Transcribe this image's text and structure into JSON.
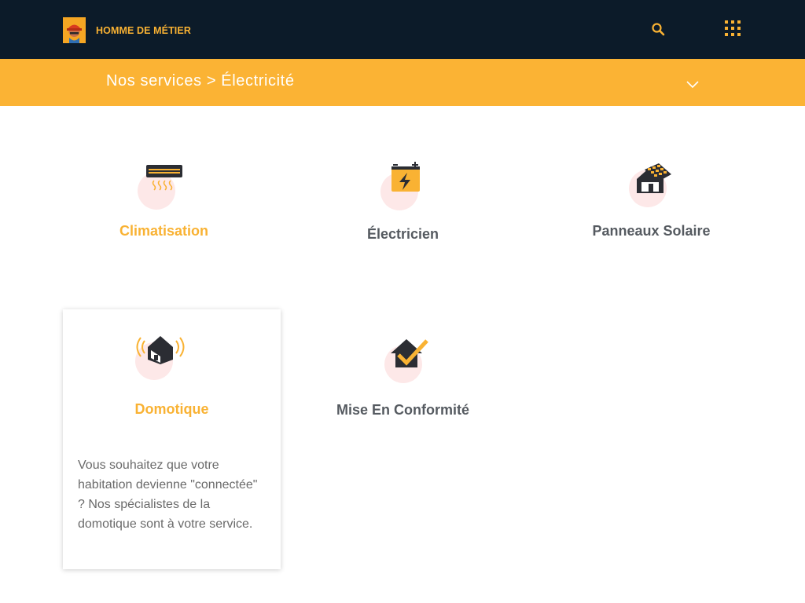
{
  "header": {
    "brand": "HOMME DE MÉTIER",
    "search_icon": "search-icon",
    "menu_icon": "apps-grid-icon"
  },
  "subheader": {
    "breadcrumb": "Nos services > Électricité",
    "toggle_icon": "chevron-down-icon"
  },
  "colors": {
    "header_bg": "#0c1b29",
    "accent": "#fbb334",
    "text_dark": "#555a60",
    "icon_circle": "#fde8e8"
  },
  "services": [
    {
      "title": "Climatisation",
      "icon": "air-conditioner-icon"
    },
    {
      "title": "Électricien",
      "icon": "battery-bolt-icon"
    },
    {
      "title": "Panneaux Solaire",
      "icon": "solar-house-icon"
    },
    {
      "title": "Domotique",
      "icon": "smart-home-icon",
      "description": "Vous souhaitez que votre habitation devienne \"connectée\" ? Nos spécialistes de la domotique sont à votre service."
    },
    {
      "title": "Mise En Conformité",
      "icon": "house-check-icon"
    }
  ]
}
